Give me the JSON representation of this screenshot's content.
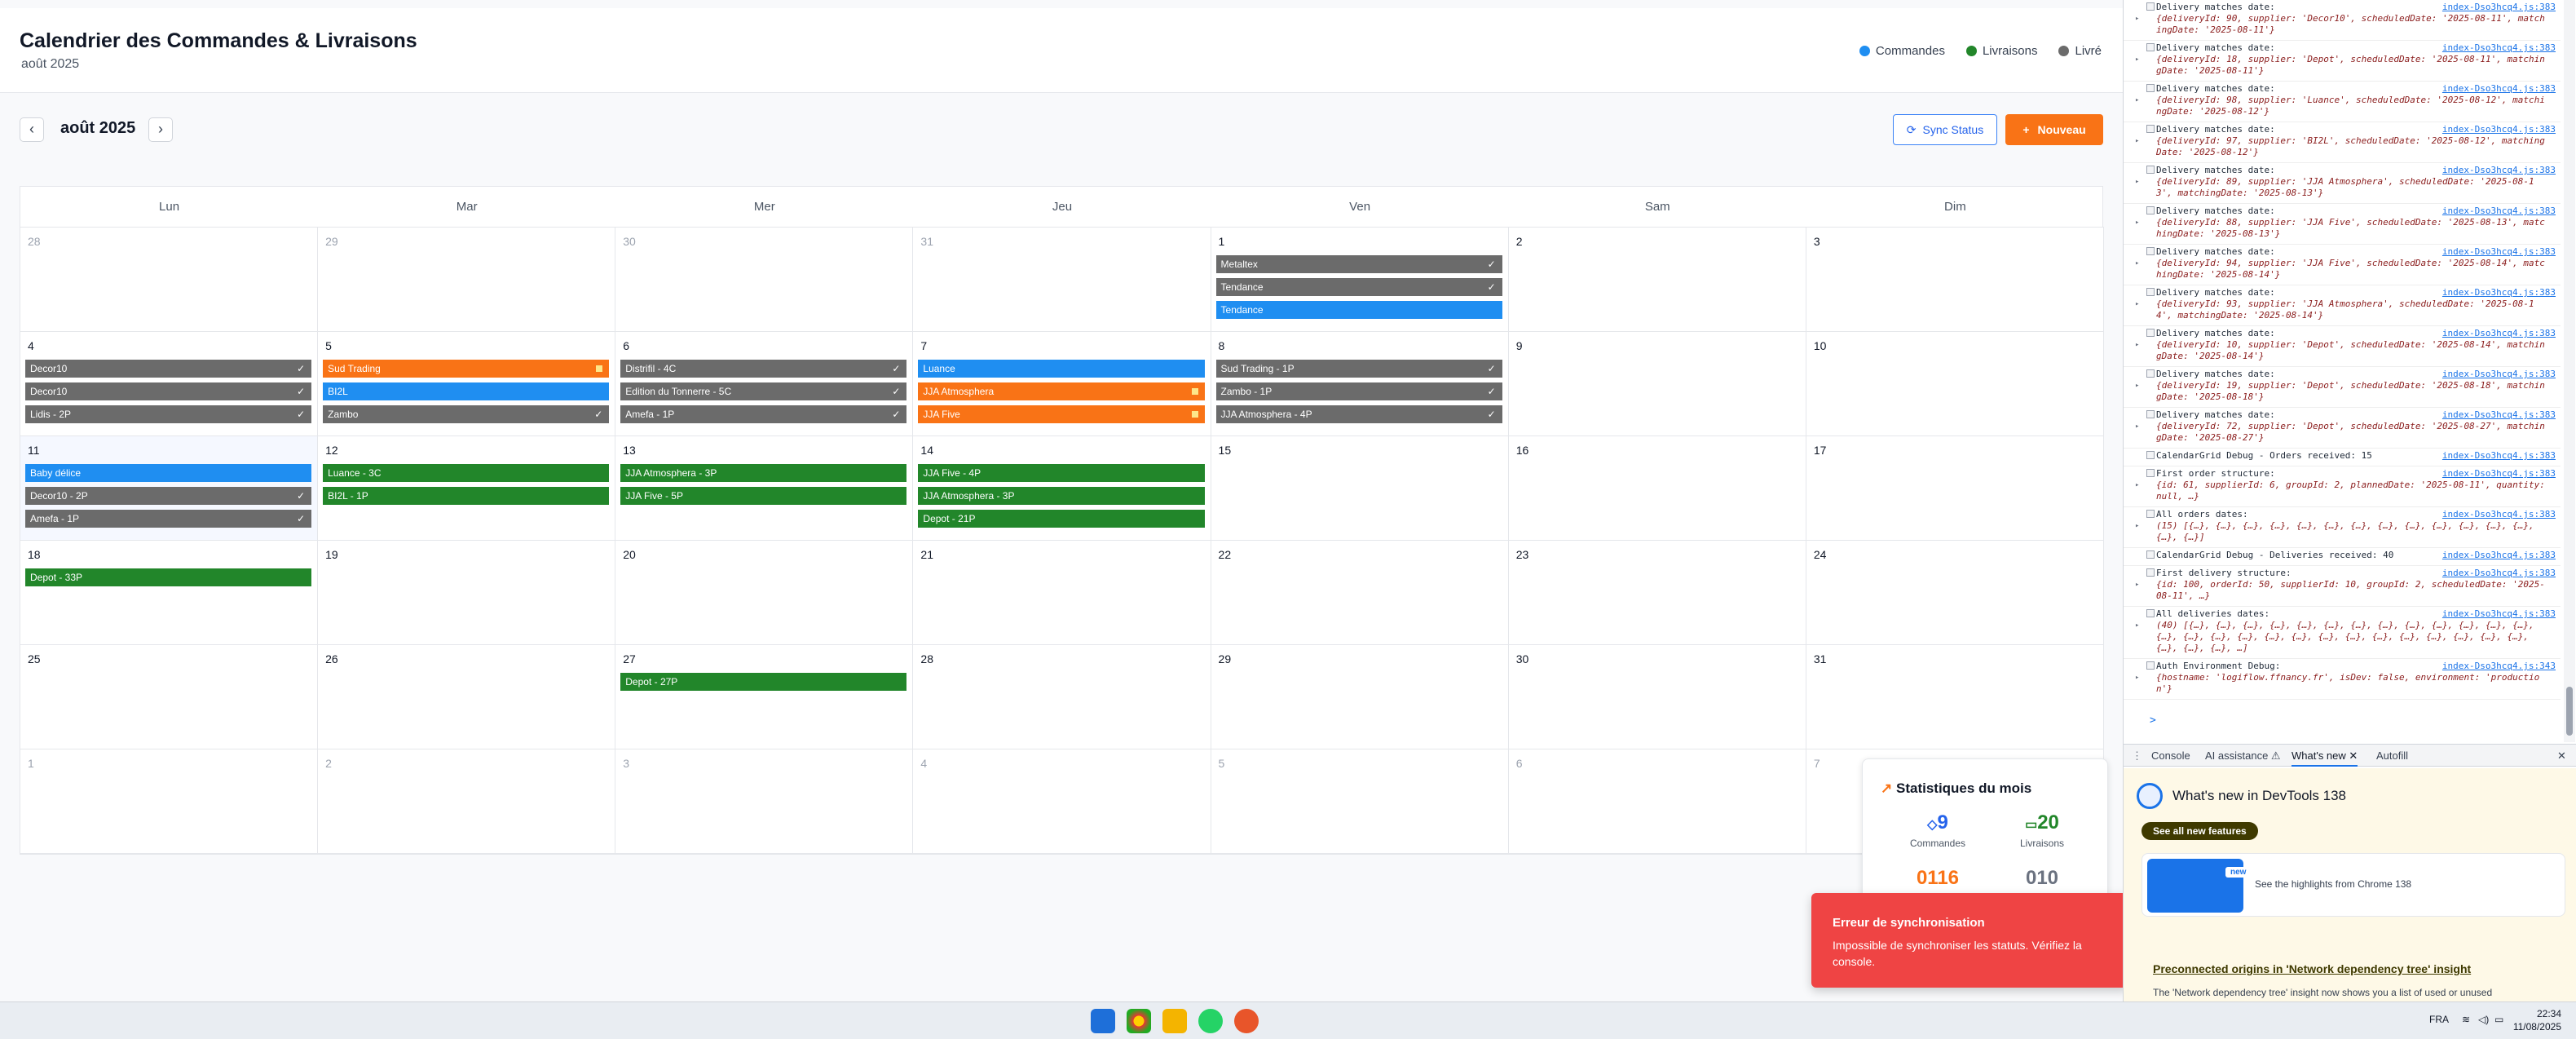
{
  "header": {
    "title": "Calendrier des Commandes & Livraisons",
    "subtitle": "août 2025",
    "legend": [
      {
        "label": "Commandes",
        "color": "#1f8ef1"
      },
      {
        "label": "Livraisons",
        "color": "#22862a"
      },
      {
        "label": "Livré",
        "color": "#6b6b6b"
      }
    ]
  },
  "nav": {
    "prev": "‹",
    "next": "›",
    "month": "août 2025",
    "sync_label": "Sync Status",
    "new_label": "Nouveau"
  },
  "days": [
    "Lun",
    "Mar",
    "Mer",
    "Jeu",
    "Ven",
    "Sam",
    "Dim"
  ],
  "colors": {
    "order": "#1f8ef1",
    "delivery": "#22862a",
    "done": "#6b6b6b",
    "pending": "#f97316"
  },
  "weeks": [
    [
      {
        "d": "28",
        "off": true
      },
      {
        "d": "29",
        "off": true
      },
      {
        "d": "30",
        "off": true
      },
      {
        "d": "31",
        "off": true
      },
      {
        "d": "1",
        "ev": [
          {
            "t": "Metaltex",
            "k": "done",
            "c": true
          },
          {
            "t": "Tendance",
            "k": "done",
            "c": true
          },
          {
            "t": "Tendance",
            "k": "order"
          }
        ]
      },
      {
        "d": "2"
      },
      {
        "d": "3"
      }
    ],
    [
      {
        "d": "4",
        "ev": [
          {
            "t": "Decor10",
            "k": "done",
            "c": true
          },
          {
            "t": "Decor10",
            "k": "done",
            "c": true
          },
          {
            "t": "Lidis - 2P",
            "k": "done",
            "c": true
          }
        ]
      },
      {
        "d": "5",
        "ev": [
          {
            "t": "Sud Trading",
            "k": "pending",
            "s": true
          },
          {
            "t": "BI2L",
            "k": "order"
          },
          {
            "t": "Zambo",
            "k": "done",
            "c": true
          }
        ]
      },
      {
        "d": "6",
        "ev": [
          {
            "t": "Distrifil - 4C",
            "k": "done",
            "c": true
          },
          {
            "t": "Edition du Tonnerre - 5C",
            "k": "done",
            "c": true
          },
          {
            "t": "Amefa - 1P",
            "k": "done",
            "c": true
          }
        ]
      },
      {
        "d": "7",
        "ev": [
          {
            "t": "Luance",
            "k": "order"
          },
          {
            "t": "JJA Atmosphera",
            "k": "pending",
            "s": true
          },
          {
            "t": "JJA Five",
            "k": "pending",
            "s": true
          }
        ]
      },
      {
        "d": "8",
        "ev": [
          {
            "t": "Sud Trading - 1P",
            "k": "done",
            "c": true
          },
          {
            "t": "Zambo - 1P",
            "k": "done",
            "c": true
          },
          {
            "t": "JJA Atmosphera - 4P",
            "k": "done",
            "c": true
          }
        ]
      },
      {
        "d": "9"
      },
      {
        "d": "10"
      }
    ],
    [
      {
        "d": "11",
        "today": true,
        "ev": [
          {
            "t": "Baby délice",
            "k": "order"
          },
          {
            "t": "Decor10 - 2P",
            "k": "done",
            "c": true
          },
          {
            "t": "Amefa - 1P",
            "k": "done",
            "c": true
          }
        ]
      },
      {
        "d": "12",
        "ev": [
          {
            "t": "Luance - 3C",
            "k": "delivery"
          },
          {
            "t": "BI2L - 1P",
            "k": "delivery"
          }
        ]
      },
      {
        "d": "13",
        "ev": [
          {
            "t": "JJA Atmosphera - 3P",
            "k": "delivery"
          },
          {
            "t": "JJA Five - 5P",
            "k": "delivery"
          }
        ]
      },
      {
        "d": "14",
        "ev": [
          {
            "t": "JJA Five - 4P",
            "k": "delivery"
          },
          {
            "t": "JJA Atmosphera - 3P",
            "k": "delivery"
          },
          {
            "t": "Depot - 21P",
            "k": "delivery"
          }
        ]
      },
      {
        "d": "15"
      },
      {
        "d": "16"
      },
      {
        "d": "17"
      }
    ],
    [
      {
        "d": "18",
        "ev": [
          {
            "t": "Depot - 33P",
            "k": "delivery"
          }
        ]
      },
      {
        "d": "19"
      },
      {
        "d": "20"
      },
      {
        "d": "21"
      },
      {
        "d": "22"
      },
      {
        "d": "23"
      },
      {
        "d": "24"
      }
    ],
    [
      {
        "d": "25"
      },
      {
        "d": "26"
      },
      {
        "d": "27",
        "ev": [
          {
            "t": "Depot - 27P",
            "k": "delivery"
          }
        ]
      },
      {
        "d": "28"
      },
      {
        "d": "29"
      },
      {
        "d": "30"
      },
      {
        "d": "31"
      }
    ],
    [
      {
        "d": "1",
        "off": true
      },
      {
        "d": "2",
        "off": true
      },
      {
        "d": "3",
        "off": true
      },
      {
        "d": "4",
        "off": true
      },
      {
        "d": "5",
        "off": true
      },
      {
        "d": "6",
        "off": true
      },
      {
        "d": "7",
        "off": true
      }
    ]
  ],
  "stats": {
    "title": "Statistiques du mois",
    "orders": "9",
    "orders_label": "Commandes",
    "deliveries": "20",
    "deliveries_label": "Livraisons",
    "pending": "0116",
    "done": "010"
  },
  "toast": {
    "title": "Erreur de synchronisation",
    "message": "Impossible de synchroniser les statuts. Vérifiez la console."
  },
  "console": [
    {
      "m": "Delivery matches date:",
      "o": "{deliveryId: 90, supplier: 'Decor10', scheduledDate: '2025-08-11', matchingDate: '2025-08-11'}"
    },
    {
      "m": "Delivery matches date:",
      "o": "{deliveryId: 18, supplier: 'Depot', scheduledDate: '2025-08-11', matchingDate: '2025-08-11'}"
    },
    {
      "m": "Delivery matches date:",
      "o": "{deliveryId: 98, supplier: 'Luance', scheduledDate: '2025-08-12', matchingDate: '2025-08-12'}"
    },
    {
      "m": "Delivery matches date:",
      "o": "{deliveryId: 97, supplier: 'BI2L', scheduledDate: '2025-08-12', matchingDate: '2025-08-12'}"
    },
    {
      "m": "Delivery matches date:",
      "o": "{deliveryId: 89, supplier: 'JJA Atmosphera', scheduledDate: '2025-08-13', matchingDate: '2025-08-13'}"
    },
    {
      "m": "Delivery matches date:",
      "o": "{deliveryId: 88, supplier: 'JJA Five', scheduledDate: '2025-08-13', matchingDate: '2025-08-13'}"
    },
    {
      "m": "Delivery matches date:",
      "o": "{deliveryId: 94, supplier: 'JJA Five', scheduledDate: '2025-08-14', matchingDate: '2025-08-14'}"
    },
    {
      "m": "Delivery matches date:",
      "o": "{deliveryId: 93, supplier: 'JJA Atmosphera', scheduledDate: '2025-08-14', matchingDate: '2025-08-14'}"
    },
    {
      "m": "Delivery matches date:",
      "o": "{deliveryId: 10, supplier: 'Depot', scheduledDate: '2025-08-14', matchingDate: '2025-08-14'}"
    },
    {
      "m": "Delivery matches date:",
      "o": "{deliveryId: 19, supplier: 'Depot', scheduledDate: '2025-08-18', matchingDate: '2025-08-18'}"
    },
    {
      "m": "Delivery matches date:",
      "o": "{deliveryId: 72, supplier: 'Depot', scheduledDate: '2025-08-27', matchingDate: '2025-08-27'}"
    },
    {
      "m": "CalendarGrid Debug - Orders received: 15",
      "o": ""
    },
    {
      "m": "First order structure:",
      "o": "{id: 61, supplierId: 6, groupId: 2, plannedDate: '2025-08-11', quantity: null, …}"
    },
    {
      "m": "All orders dates:",
      "o": "(15) [{…}, {…}, {…}, {…}, {…}, {…}, {…}, {…}, {…}, {…}, {…}, {…}, {…}, {…}, {…}]"
    },
    {
      "m": "CalendarGrid Debug - Deliveries received: 40",
      "o": ""
    },
    {
      "m": "First delivery structure:",
      "o": "{id: 100, orderId: 50, supplierId: 10, groupId: 2, scheduledDate: '2025-08-11', …}"
    },
    {
      "m": "All deliveries dates:",
      "o": "(40) [{…}, {…}, {…}, {…}, {…}, {…}, {…}, {…}, {…}, {…}, {…}, {…}, {…}, {…}, {…}, {…}, {…}, {…}, {…}, {…}, {…}, {…}, {…}, {…}, {…}, {…}, {…}, {…}, {…}, {…}, …]"
    },
    {
      "m": "Auth Environment Debug:",
      "o": "{hostname: 'logiflow.ffnancy.fr', isDev: false, environment: 'production'}"
    }
  ],
  "console_src": "index-Dso3hcq4.js:383",
  "console_src2": "index-Dso3hcq4.js:343",
  "console_prompt": ">",
  "devtools": {
    "tabs": [
      "Console",
      "AI assistance ⚠",
      "What's new ✕",
      "Autofill"
    ],
    "close": "✕",
    "title": "What's new in DevTools 138",
    "pill": "See all new features",
    "badge": "new",
    "card_text": "See the highlights from Chrome 138",
    "link": "Preconnected origins in 'Network dependency tree' insight",
    "desc": "The 'Network dependency tree' insight now shows you a list of used or unused"
  },
  "taskbar": {
    "lang": "FRA",
    "time": "22:34",
    "date": "11/08/2025"
  }
}
